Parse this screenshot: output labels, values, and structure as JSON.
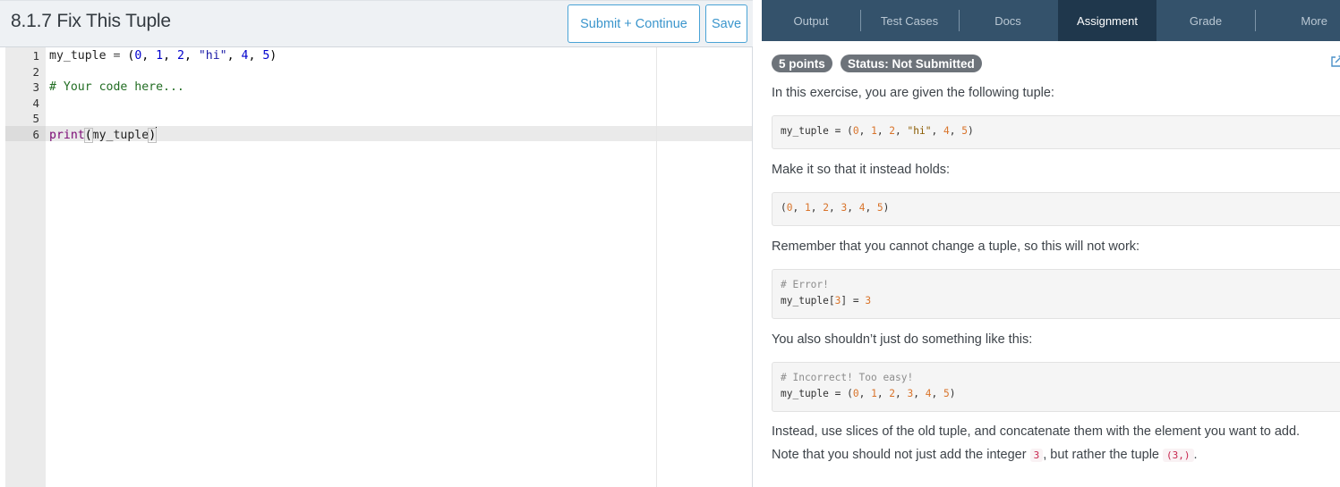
{
  "editor": {
    "title": "8.1.7 Fix This Tuple",
    "submit_label": "Submit + Continue",
    "save_label": "Save",
    "line_numbers": [
      "1",
      "2",
      "3",
      "4",
      "5",
      "6"
    ],
    "line1": {
      "var": "my_tuple",
      "op": " = ",
      "open": "(",
      "n0": "0",
      "c1": ", ",
      "n1": "1",
      "c2": ", ",
      "n2": "2",
      "c3": ", ",
      "s": "\"hi\"",
      "c4": ", ",
      "n4": "4",
      "c5": ", ",
      "n5": "5",
      "close": ")"
    },
    "line3": "# Your code here...",
    "line6": {
      "fn": "print",
      "open": "(",
      "arg": "my_tuple",
      "close": ")"
    }
  },
  "tabs": [
    {
      "label": "Output"
    },
    {
      "label": "Test Cases"
    },
    {
      "label": "Docs"
    },
    {
      "label": "Assignment",
      "active": true
    },
    {
      "label": "Grade"
    },
    {
      "label": "More"
    }
  ],
  "assignment": {
    "points": "5 points",
    "status": "Status: Not Submitted",
    "p1": "In this exercise, you are given the following tuple:",
    "code1": {
      "a": "my_tuple = (",
      "n0": "0",
      "s1": ", ",
      "n1": "1",
      "s2": ", ",
      "n2": "2",
      "s3": ", ",
      "str": "\"hi\"",
      "s4": ", ",
      "n4": "4",
      "s5": ", ",
      "n5": "5",
      "close": ")"
    },
    "p2": "Make it so that it instead holds:",
    "code2": {
      "open": "(",
      "n0": "0",
      "s1": ", ",
      "n1": "1",
      "s2": ", ",
      "n2": "2",
      "s3": ", ",
      "n3": "3",
      "s4": ", ",
      "n4": "4",
      "s5": ", ",
      "n5": "5",
      "close": ")"
    },
    "p3": "Remember that you cannot change a tuple, so this will not work:",
    "code3": {
      "comment": "# Error!",
      "a": "my_tuple[",
      "idx": "3",
      "b": "] = ",
      "val": "3"
    },
    "p4": "You also shouldn’t just do something like this:",
    "code4": {
      "comment": "# Incorrect! Too easy!",
      "a": "my_tuple = (",
      "n0": "0",
      "s1": ", ",
      "n1": "1",
      "s2": ", ",
      "n2": "2",
      "s3": ", ",
      "n3": "3",
      "s4": ", ",
      "n4": "4",
      "s5": ", ",
      "n5": "5",
      "close": ")"
    },
    "p5": "Instead, use slices of the old tuple, and concatenate them with the element you want to add.",
    "p6_a": "Note that you should not just add the integer ",
    "p6_code1": "3",
    "p6_b": ", but rather the tuple ",
    "p6_code2": "(3,)",
    "p6_c": "."
  },
  "colors": {
    "tab_bar": "#34526b",
    "tab_active": "#1f374c",
    "button_accent": "#4aa3d6",
    "badge": "#6d737a"
  },
  "icons": [
    "edit-external-icon"
  ]
}
